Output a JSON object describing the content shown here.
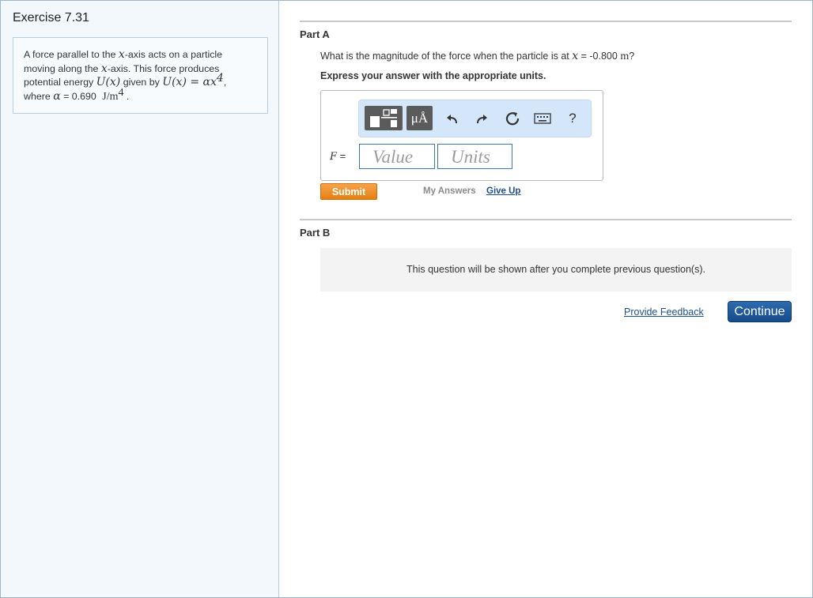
{
  "exercise": {
    "title": "Exercise 7.31",
    "problem": {
      "line1": "A force parallel to the ",
      "x1": "x",
      "line1b": "-axis acts on a particle",
      "line2a": "moving along the ",
      "x2": "x",
      "line2b": "-axis. This force produces",
      "line3a": "potential energy ",
      "Ux": "U(x)",
      "line3b": " given by ",
      "formula": "U(x) = αx",
      "formula_exp": "4",
      "line3c": ",",
      "line4a": "where ",
      "alpha": "α",
      "line4b": " = 0.690 ",
      "units": "J/m",
      "units_exp": "4",
      "line4c": " ."
    }
  },
  "partA": {
    "label": "Part A",
    "question_a": "What is the magnitude of the force when the particle is at ",
    "question_x": "x",
    "question_b": " = -0.800 ",
    "question_unit": "m",
    "question_c": "?",
    "instruction": "Express your answer with the appropriate units.",
    "toolbar": {
      "template_icon": "template-icon",
      "units_label": "μÅ",
      "undo_icon": "undo-icon",
      "redo_icon": "redo-icon",
      "reset_icon": "reset-icon",
      "keyboard_icon": "keyboard-icon",
      "help_label": "?"
    },
    "variable": "F",
    "equals": " =",
    "value_placeholder": "Value",
    "units_placeholder": "Units",
    "submit_label": "Submit",
    "my_answers_label": "My Answers",
    "give_up_label": "Give Up"
  },
  "partB": {
    "label": "Part B",
    "message": "This question will be shown after you complete previous question(s)."
  },
  "footer": {
    "feedback_label": "Provide Feedback",
    "continue_label": "Continue"
  },
  "colors": {
    "sidebar_bg": "#f3f8fd",
    "toolbar_bg": "#d4e6fa",
    "submit_orange": "#e57f12",
    "continue_blue": "#1d5b9e",
    "link_blue": "#1d4f8e"
  }
}
